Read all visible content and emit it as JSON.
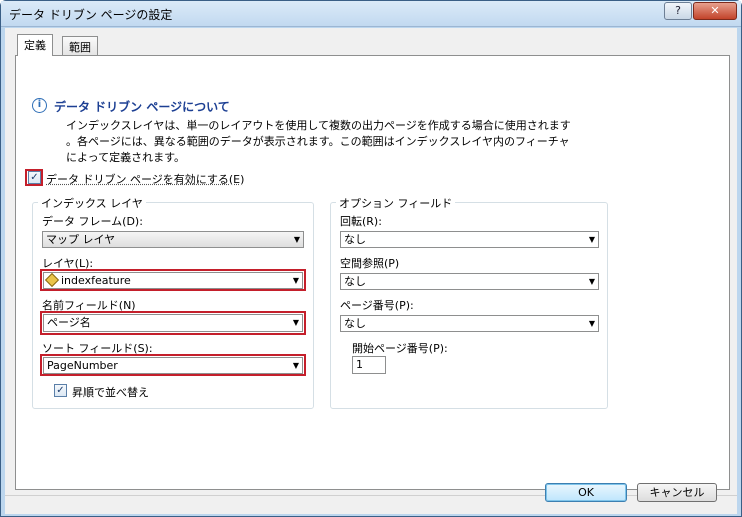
{
  "window": {
    "title": "データ ドリブン ページの設定",
    "help_label": "?",
    "close_label": "✕"
  },
  "tabs": [
    {
      "label": "定義",
      "active": true
    },
    {
      "label": "範囲",
      "active": false
    }
  ],
  "info": {
    "icon": "info-icon",
    "heading": "データ ドリブン ページについて",
    "lines": [
      "インデックスレイヤは、単一のレイアウトを使用して複数の出力ページを作成する場合に使用されます",
      "。各ページには、異なる範囲のデータが表示されます。この範囲はインデックスレイヤ内のフィーチャ",
      "によって定義されます。"
    ]
  },
  "enable": {
    "label": "データ ドリブン ページを有効にする(E)",
    "checked": true
  },
  "index_layer": {
    "title": "インデックス レイヤ",
    "frame_label": "データ フレーム(D):",
    "frame_value": "マップ レイヤ",
    "layer_label": "レイヤ(L):",
    "layer_value": "indexfeature",
    "name_label": "名前フィールド(N)",
    "name_value": "ページ名",
    "sort_label": "ソート フィールド(S):",
    "sort_value": "PageNumber",
    "ascending_label": "昇順で並べ替え",
    "ascending_checked": true
  },
  "options": {
    "title": "オプション フィールド",
    "rotation_label": "回転(R):",
    "rotation_value": "なし",
    "spatial_label": "空間参照(P)",
    "spatial_value": "なし",
    "page_number_label": "ページ番号(P):",
    "page_number_value": "なし",
    "start_label": "開始ページ番号(P):",
    "start_value": "1"
  },
  "buttons": {
    "ok": "OK",
    "cancel": "キャンセル"
  },
  "colors": {
    "highlight": "#c41f2b",
    "heading": "#1c3f93"
  }
}
